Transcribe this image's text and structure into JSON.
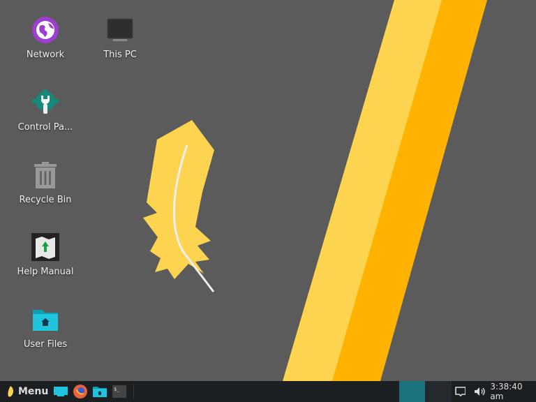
{
  "desktop": {
    "icons": [
      {
        "label": "Network",
        "icon": "network-globe-icon"
      },
      {
        "label": "This PC",
        "icon": "computer-monitor-icon"
      },
      {
        "label": "Control Pa...",
        "icon": "control-panel-gear-icon"
      },
      {
        "label": "Recycle Bin",
        "icon": "trash-icon"
      },
      {
        "label": "Help Manual",
        "icon": "map-book-icon"
      },
      {
        "label": "User Files",
        "icon": "home-folder-icon"
      }
    ]
  },
  "taskbar": {
    "menu_label": "Menu",
    "clock": "3:38:40 am"
  },
  "colors": {
    "background": "#5b5b5b",
    "stripe_light": "#fdd44f",
    "stripe_dark": "#ffb300",
    "taskbar": "#1b1f22",
    "accent": "#18737e"
  }
}
